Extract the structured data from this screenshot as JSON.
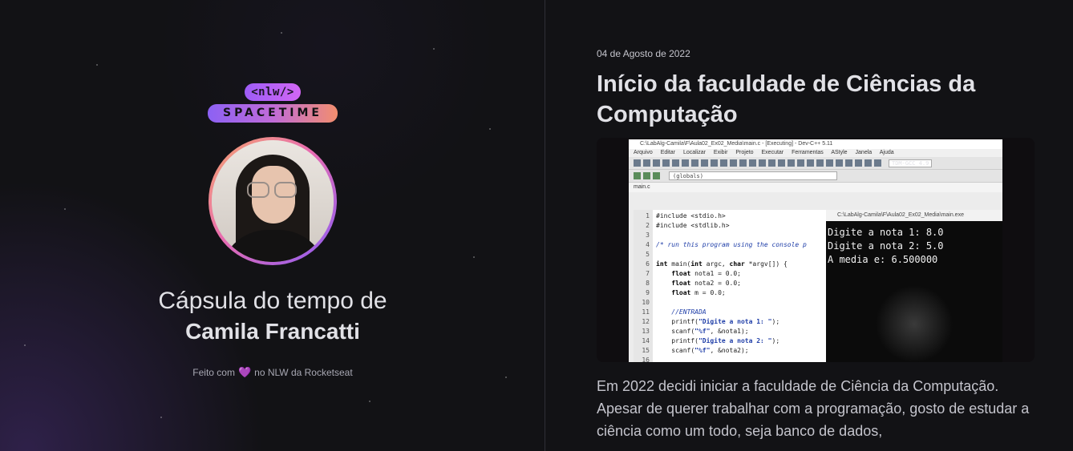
{
  "left": {
    "logo_top": "<nlw/>",
    "logo_bottom": "SPACETIME",
    "title_line1": "Cápsula do tempo de",
    "title_name": "Camila Francatti",
    "footer_before": "Feito com",
    "footer_heart": "💜",
    "footer_after": "no NLW da Rocketseat"
  },
  "post": {
    "date": "04 de Agosto de 2022",
    "title": "Início da faculdade de Ciências da Computação",
    "text": "Em 2022 decidi iniciar a faculdade de Ciência da Computação. Apesar de querer trabalhar com a programação, gosto de estudar a ciência como um todo, seja banco de dados,"
  },
  "photo": {
    "window_title": "C:\\LabAlg-Camila\\F\\Aula02_Ex02_Media\\main.c - [Executing] - Dev-C++ 5.11",
    "menu": [
      "Arquivo",
      "Editar",
      "Localizar",
      "Exibir",
      "Projeto",
      "Executar",
      "Ferramentas",
      "AStyle",
      "Janela",
      "Ajuda"
    ],
    "compiler": "TDM-GCC 4.9",
    "scope": "(globals)",
    "tab": "main.c",
    "line_numbers": "1\n2\n3\n4\n5\n6\n7\n8\n9\n10\n11\n12\n13\n14\n15\n16",
    "console_title": "C:\\LabAlg-Camila\\F\\Aula02_Ex02_Media\\main.exe",
    "console_output": "Digite a nota 1: 8.0\nDigite a nota 2: 5.0\nA media e: 6.500000"
  },
  "colors": {
    "background": "#121215",
    "accent_purple": "#8c61f4",
    "accent_pink": "#e86cb0",
    "accent_orange": "#f5a66b"
  }
}
